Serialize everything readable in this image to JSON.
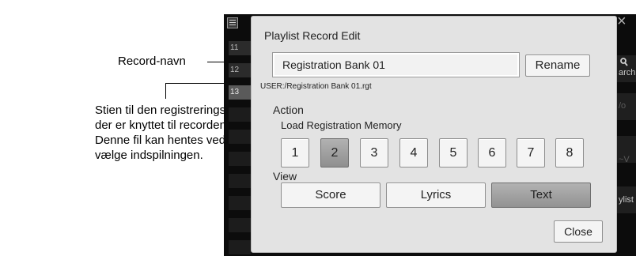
{
  "annotations": {
    "record_name": "Record-navn",
    "path_desc_lines": [
      "Stien til den registreringsbankfil,",
      "der er knyttet til recorden.",
      "Denne fil kan hentes ved at",
      "vælge indspilningen."
    ]
  },
  "background_app": {
    "list_numbers": [
      "11",
      "12",
      "13"
    ],
    "close_glyph": "×",
    "search_label": "arch",
    "right_fragment_1": "/o",
    "right_fragment_2": "~V",
    "playlist_label": "ylist"
  },
  "dialog": {
    "title": "Playlist Record Edit",
    "name_value": "Registration Bank 01",
    "rename_label": "Rename",
    "path": "USER:/Registration Bank 01.rgt",
    "action_label": "Action",
    "memory_label": "Load Registration Memory",
    "memory_buttons": [
      "1",
      "2",
      "3",
      "4",
      "5",
      "6",
      "7",
      "8"
    ],
    "memory_selected": "2",
    "view_label": "View",
    "view_buttons": [
      "Score",
      "Lyrics",
      "Text"
    ],
    "view_selected": "Text",
    "close_label": "Close"
  },
  "colors": {
    "dialog_bg": "#e3e3e3",
    "app_bg": "#0c0c0c",
    "selected_button": "#9c9c9c"
  }
}
